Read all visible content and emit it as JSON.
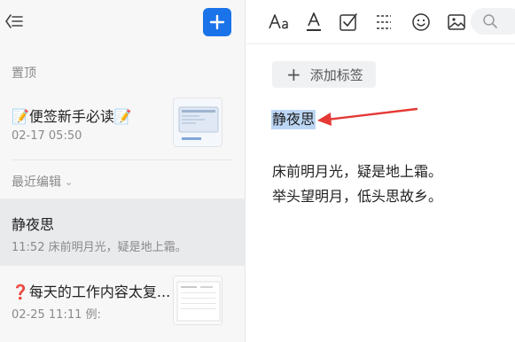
{
  "sidebar": {
    "pinned_label": "置顶",
    "recent_label": "最近编辑",
    "notes": [
      {
        "title": "📝便签新手必读📝",
        "meta": "02-17 05:50"
      },
      {
        "title": "静夜思",
        "meta": "11:52 床前明月光，疑是地上霜。"
      },
      {
        "title": "❓每天的工作内容太复...",
        "meta": "02-25 11:11 例:"
      }
    ]
  },
  "toolbar": {
    "icons": [
      "font-size-icon",
      "font-color-icon",
      "checkbox-icon",
      "divider-icon",
      "emoji-icon",
      "image-icon",
      "search-icon"
    ]
  },
  "editor": {
    "tag_button": "添加标签",
    "title": "静夜思",
    "lines": [
      "床前明月光，疑是地上霜。",
      "举头望明月，低头思故乡。"
    ]
  },
  "colors": {
    "accent": "#1a73e8",
    "selection": "#bcd6f5",
    "annotation_arrow": "#e53935"
  }
}
